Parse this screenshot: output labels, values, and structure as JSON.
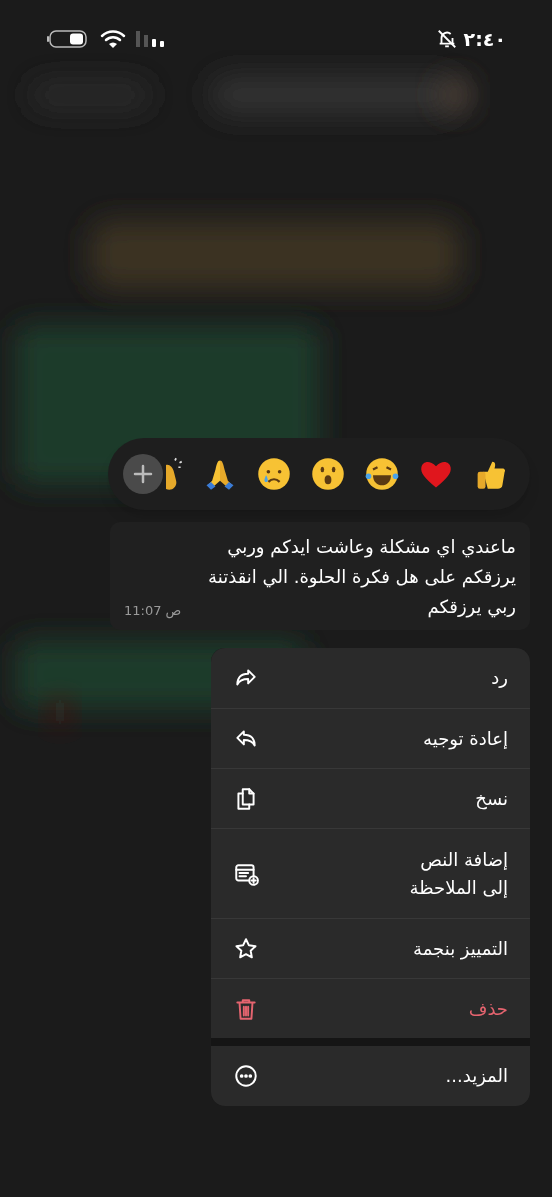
{
  "status_bar": {
    "time": "٢:٤٠",
    "silent": true
  },
  "message": {
    "text": "ماعندي اي مشكلة وعاشت ايدكم وربي يرزقكم على هل فكرة  الحلوة. الي انقذتنة ربي يرزقكم",
    "time": "11:07 ص"
  },
  "menu": [
    {
      "label": "رد",
      "kind": "action"
    },
    {
      "label": "إعادة توجيه",
      "kind": "action"
    },
    {
      "label": "نسخ",
      "kind": "action"
    },
    {
      "label": "إضافة النص\nإلى الملاحظة",
      "kind": "action"
    },
    {
      "label": "التمييز بنجمة",
      "kind": "action"
    },
    {
      "label": "حذف",
      "kind": "destructive"
    },
    {
      "label": "المزيد...",
      "kind": "separate"
    }
  ]
}
